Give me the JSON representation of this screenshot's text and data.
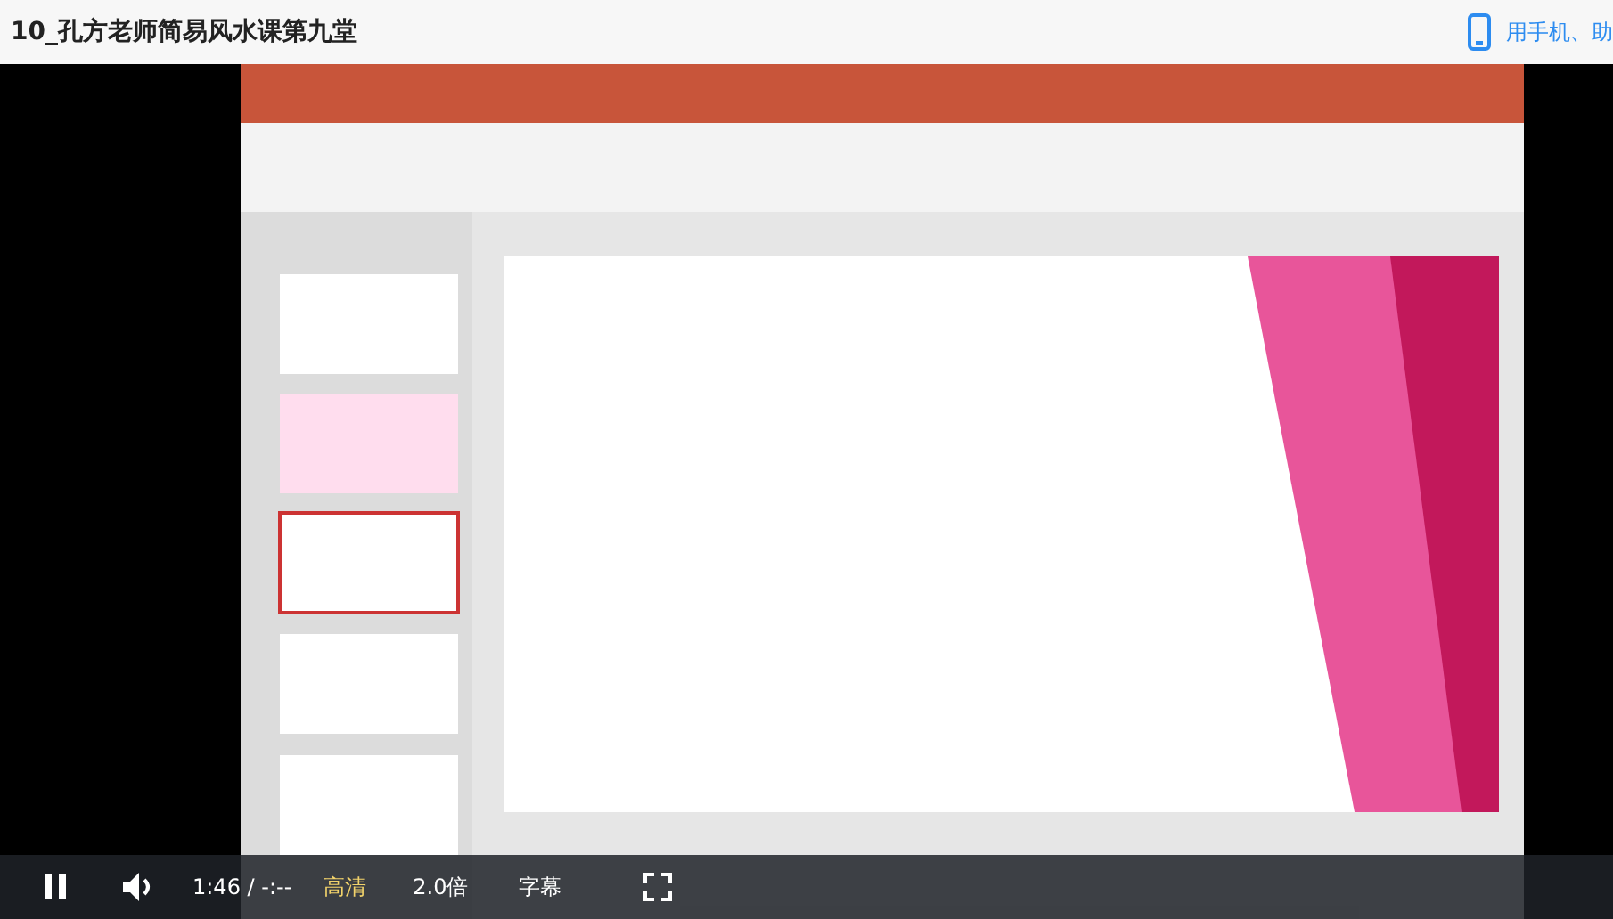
{
  "page": {
    "title": "10_孔方老师简易风水课第九堂",
    "mobile_link": "用手机、助"
  },
  "player": {
    "playing": true,
    "muted": false,
    "time": "1:46 / -:--",
    "quality": "高清",
    "speed": "2.0倍",
    "subtitles": "字幕"
  }
}
